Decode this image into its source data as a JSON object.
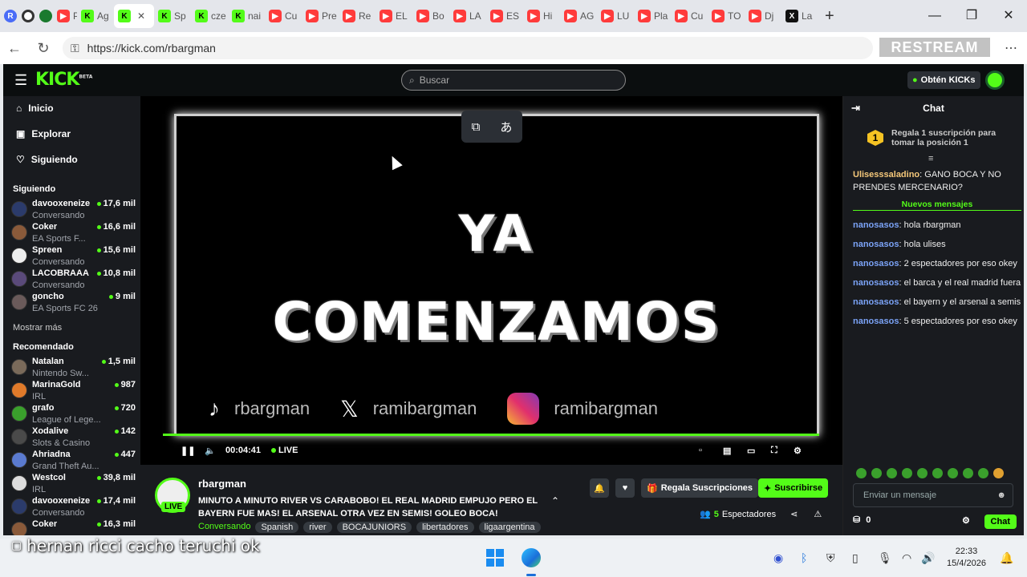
{
  "browser": {
    "tabs": [
      {
        "icon": "r",
        "label": ""
      },
      {
        "icon": "o",
        "label": ""
      },
      {
        "icon": "g",
        "label": ""
      },
      {
        "icon": "yt",
        "label": "PR"
      },
      {
        "icon": "k",
        "label": "Ag"
      },
      {
        "icon": "k",
        "label": ""
      },
      {
        "icon": "k",
        "label": "Sp"
      },
      {
        "icon": "k",
        "label": "cze"
      },
      {
        "icon": "k",
        "label": "nai"
      },
      {
        "icon": "yt",
        "label": "Cu"
      },
      {
        "icon": "yt",
        "label": "Pre"
      },
      {
        "icon": "yt",
        "label": "Re"
      },
      {
        "icon": "yt",
        "label": "EL"
      },
      {
        "icon": "yt",
        "label": "Bo"
      },
      {
        "icon": "yt",
        "label": "LA"
      },
      {
        "icon": "yt",
        "label": "ES"
      },
      {
        "icon": "yt",
        "label": "Hi"
      },
      {
        "icon": "yt",
        "label": "AG"
      },
      {
        "icon": "yt",
        "label": "LU"
      },
      {
        "icon": "yt",
        "label": "Pla"
      },
      {
        "icon": "yt",
        "label": "Cu"
      },
      {
        "icon": "yt",
        "label": "TO"
      },
      {
        "icon": "yt",
        "label": "Dj"
      },
      {
        "icon": "x",
        "label": "La"
      }
    ],
    "url": "https://kick.com/rbargman",
    "overlay": "RESTREAM"
  },
  "kick": {
    "logo": "KICK",
    "logo_sup": "BETA",
    "search_placeholder": "Buscar",
    "get_kicks": "Obtén KICKs",
    "nav": [
      {
        "icon": "home-icon",
        "glyph": "⌂",
        "label": "Inicio"
      },
      {
        "icon": "explore-icon",
        "glyph": "▣",
        "label": "Explorar"
      },
      {
        "icon": "heart-icon",
        "glyph": "♡",
        "label": "Siguiendo"
      }
    ],
    "following_header": "Siguiendo",
    "following": [
      {
        "name": "davooxeneize",
        "viewers": "17,6 mil",
        "game": "Conversando",
        "color": "#2b3b6b"
      },
      {
        "name": "Coker",
        "viewers": "16,6 mil",
        "game": "EA Sports F...",
        "color": "#8a5a3a"
      },
      {
        "name": "Spreen",
        "viewers": "15,6 mil",
        "game": "Conversando",
        "color": "#eeeeee"
      },
      {
        "name": "LACOBRAAA",
        "viewers": "10,8 mil",
        "game": "Conversando",
        "color": "#5a4a7a"
      },
      {
        "name": "goncho",
        "viewers": "9 mil",
        "game": "EA Sports FC 26",
        "color": "#6a5a5a"
      }
    ],
    "show_more": "Mostrar más",
    "recommended_header": "Recomendado",
    "recommended": [
      {
        "name": "Natalan",
        "viewers": "1,5 mil",
        "game": "Nintendo Sw...",
        "color": "#7a6a5a"
      },
      {
        "name": "MarinaGold",
        "viewers": "987",
        "game": "IRL",
        "color": "#e07a2a"
      },
      {
        "name": "grafo",
        "viewers": "720",
        "game": "League of Lege...",
        "color": "#3aa02c"
      },
      {
        "name": "Xodalive",
        "viewers": "142",
        "game": "Slots & Casino",
        "color": "#4a4a4a"
      },
      {
        "name": "Ahriadna",
        "viewers": "447",
        "game": "Grand Theft Au...",
        "color": "#5a7ad0"
      },
      {
        "name": "Westcol",
        "viewers": "39,8 mil",
        "game": "IRL",
        "color": "#dddddd"
      },
      {
        "name": "davooxeneize",
        "viewers": "17,4 mil",
        "game": "Conversando",
        "color": "#2b3b6b"
      },
      {
        "name": "Coker",
        "viewers": "16,3 mil",
        "game": "",
        "color": "#8a5a3a"
      }
    ],
    "video": {
      "line1": "YA",
      "line2": "COMENZAMOS",
      "tiktok": "rbargman",
      "x": "ramibargman",
      "instagram": "ramibargman",
      "time": "00:04:41",
      "live": "LIVE",
      "progress_fraction": 1.0
    },
    "stream": {
      "channel": "rbargman",
      "live_badge": "LIVE",
      "title": "MINUTO A MINUTO RIVER VS CARABOBO! EL REAL MADRID EMPUJO PERO EL BAYERN FUE MAS! EL ARSENAL OTRA VEZ EN SEMIS! GOLEO BOCA!",
      "category": "Conversando",
      "tags": [
        "Spanish",
        "river",
        "BOCAJUNIORS",
        "libertadores",
        "ligaargentina"
      ],
      "gift_subs": "Regala Suscripciones",
      "subscribe": "Suscribirse",
      "viewers_count": "5",
      "viewers_label": "Espectadores"
    },
    "chat": {
      "title": "Chat",
      "promo": "Regala 1 suscripción para tomar la posición 1",
      "promo_rank": "1",
      "new_messages": "Nuevos mensajes",
      "first": {
        "user": "Ulisesssaladino",
        "text": "GANO BOCA Y NO PRENDES MERCENARIO?"
      },
      "messages": [
        {
          "user": "nanosasos",
          "text": "hola rbargman"
        },
        {
          "user": "nanosasos",
          "text": "hola ulises"
        },
        {
          "user": "nanosasos",
          "text": "2 espectadores por eso okey"
        },
        {
          "user": "nanosasos",
          "text": "el barca y el real madrid fuera"
        },
        {
          "user": "nanosasos",
          "text": "el bayern y el arsenal a semis"
        },
        {
          "user": "nanosasos",
          "text": "5 espectadores por eso okey"
        }
      ],
      "input_placeholder": "Enviar un mensaje",
      "kicks_count": "0",
      "send": "Chat"
    }
  },
  "caption": "hernan ricci cacho teruchi ok",
  "taskbar": {
    "time": "22:33",
    "date": "15/4/2026"
  }
}
